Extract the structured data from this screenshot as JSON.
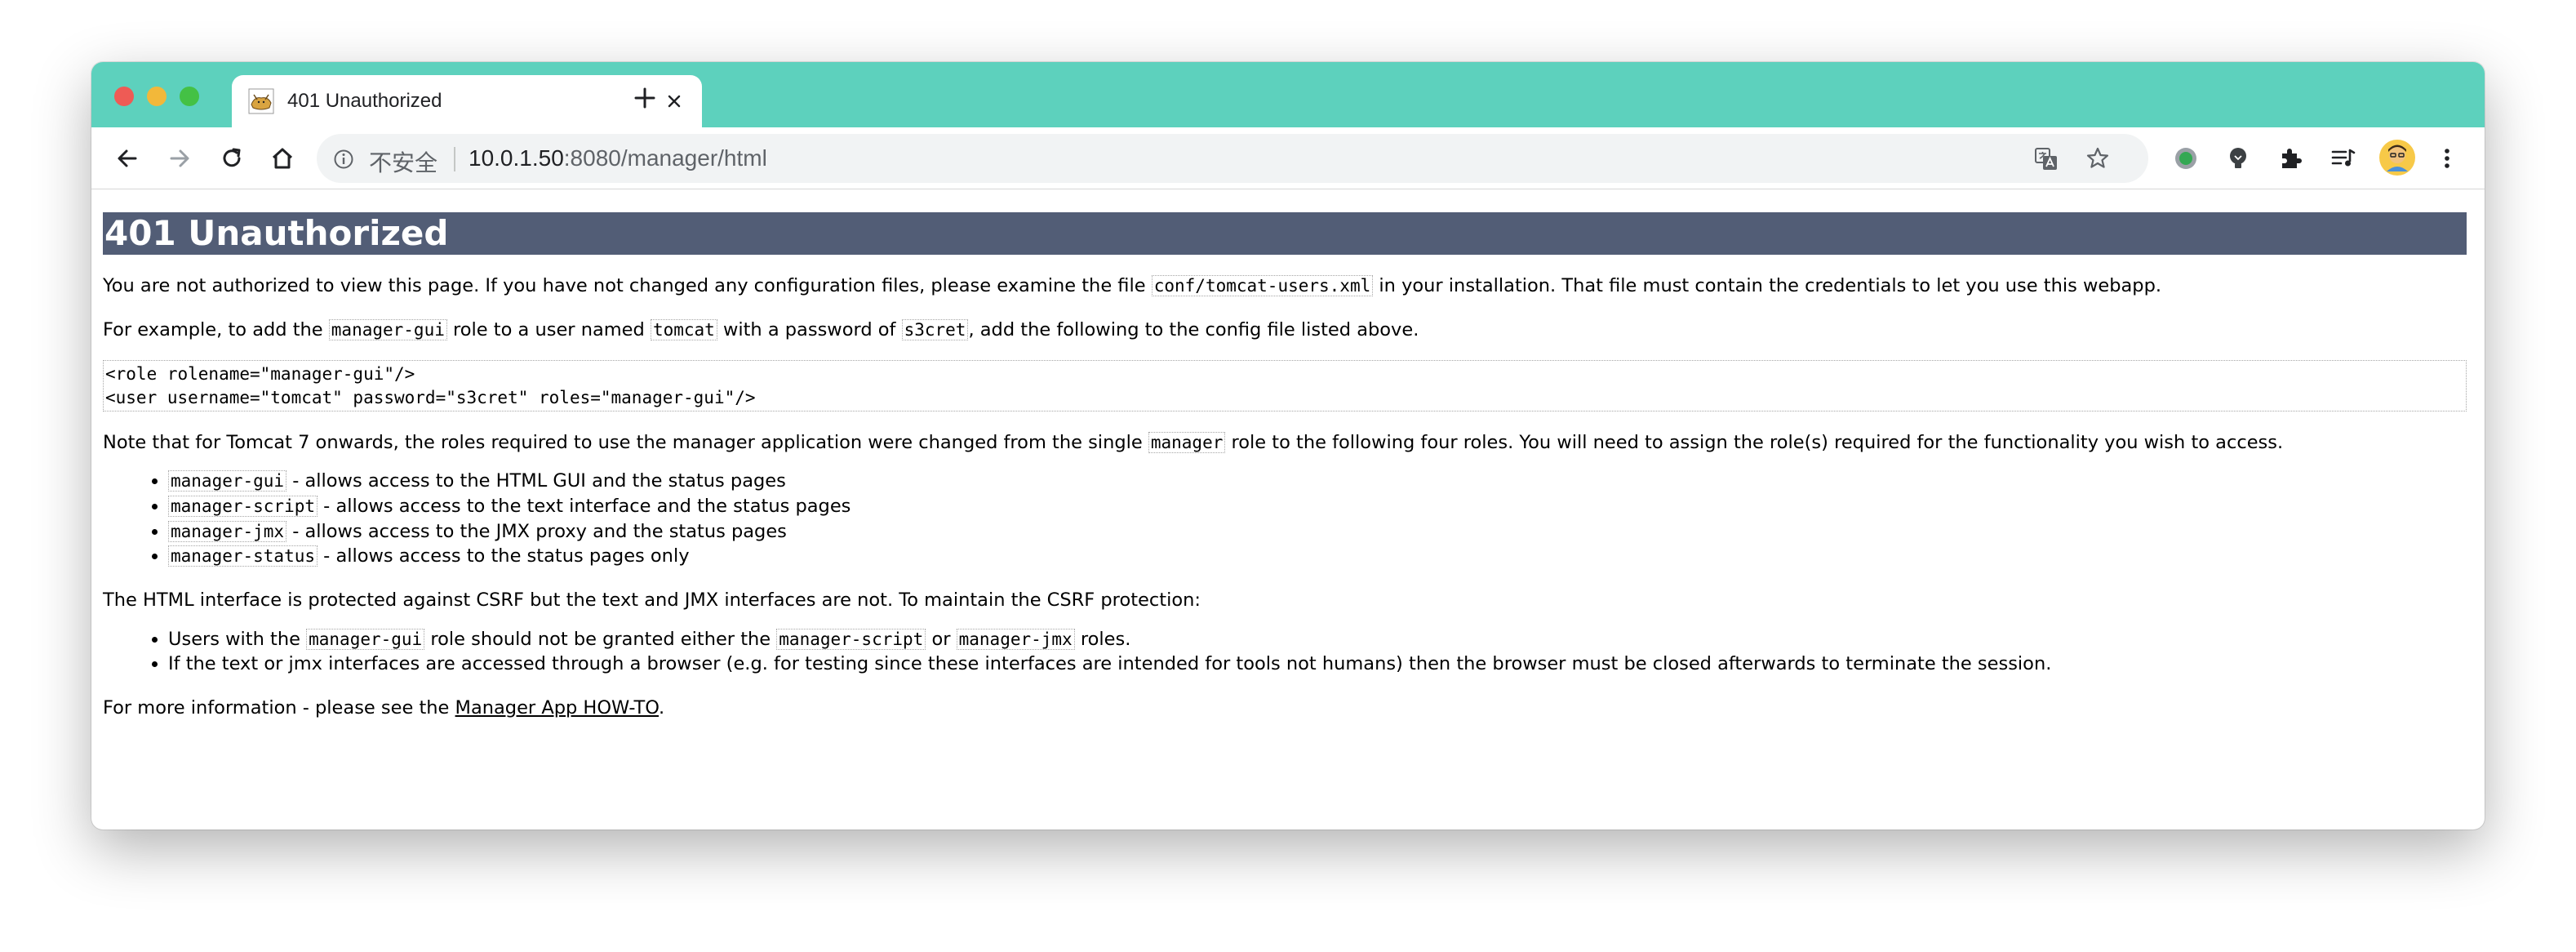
{
  "browser": {
    "tab": {
      "title": "401 Unauthorized"
    },
    "address": {
      "security_label": "不安全",
      "host": "10.0.1.50",
      "path": ":8080/manager/html"
    },
    "accent": "#5dd1bd"
  },
  "page": {
    "heading": "401 Unauthorized",
    "p1": {
      "before": "You are not authorized to view this page. If you have not changed any configuration files, please examine the file ",
      "code": "conf/tomcat-users.xml",
      "after": " in your installation. That file must contain the credentials to let you use this webapp."
    },
    "p2": {
      "a": "For example, to add the ",
      "code1": "manager-gui",
      "b": " role to a user named ",
      "code2": "tomcat",
      "c": " with a password of ",
      "code3": "s3cret",
      "d": ", add the following to the config file listed above."
    },
    "pre": {
      "line1": "<role rolename=\"manager-gui\"/>",
      "line2": "<user username=\"tomcat\" password=\"s3cret\" roles=\"manager-gui\"/>"
    },
    "p3": {
      "before": "Note that for Tomcat 7 onwards, the roles required to use the manager application were changed from the single ",
      "code": "manager",
      "after": " role to the following four roles. You will need to assign the role(s) required for the functionality you wish to access."
    },
    "roles": [
      {
        "code": "manager-gui",
        "text": " - allows access to the HTML GUI and the status pages"
      },
      {
        "code": "manager-script",
        "text": " - allows access to the text interface and the status pages"
      },
      {
        "code": "manager-jmx",
        "text": " - allows access to the JMX proxy and the status pages"
      },
      {
        "code": "manager-status",
        "text": " - allows access to the status pages only"
      }
    ],
    "p4": "The HTML interface is protected against CSRF but the text and JMX interfaces are not. To maintain the CSRF protection:",
    "csrf": {
      "item1": {
        "a": "Users with the ",
        "code1": "manager-gui",
        "b": " role should not be granted either the ",
        "code2": "manager-script",
        "c": " or ",
        "code3": "manager-jmx",
        "d": " roles."
      },
      "item2": "If the text or jmx interfaces are accessed through a browser (e.g. for testing since these interfaces are intended for tools not humans) then the browser must be closed afterwards to terminate the session."
    },
    "p5": {
      "before": "For more information - please see the ",
      "link": "Manager App HOW-TO",
      "after": "."
    }
  }
}
